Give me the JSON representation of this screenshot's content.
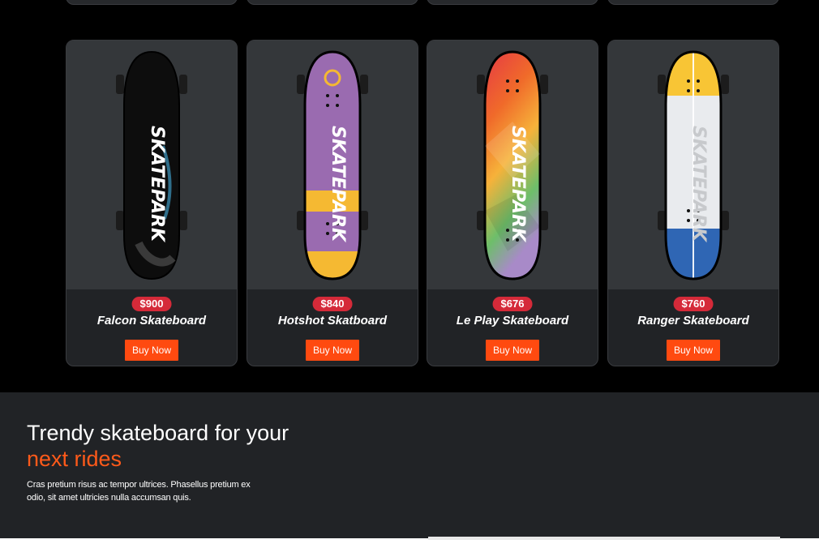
{
  "products": [
    {
      "price": "$900",
      "name": "Falcon Skateboard",
      "buy_label": "Buy Now",
      "deck_color": "#101010",
      "brand_text": "SKATEPARK"
    },
    {
      "price": "$840",
      "name": "Hotshot Skatboard",
      "buy_label": "Buy Now",
      "deck_color": "#9a6bb0",
      "brand_text": "SKATEPARK"
    },
    {
      "price": "$676",
      "name": "Le Play Skateboard",
      "buy_label": "Buy Now",
      "deck_color": "#e8542c",
      "brand_text": "SKATEPARK"
    },
    {
      "price": "$760",
      "name": "Ranger Skateboard",
      "buy_label": "Buy Now",
      "deck_color": "#e9ebee",
      "brand_text": "SKATEPARK"
    }
  ],
  "section": {
    "title": "Trendy skateboard for your",
    "accent": "next rides",
    "text": "Cras pretium risus ac tempor ultrices. Phasellus pretium ex odio, sit amet ultricies nulla accumsan quis."
  },
  "colors": {
    "accent": "#ff5a1a",
    "price_badge": "#d52a39",
    "button": "#ff4a10"
  }
}
